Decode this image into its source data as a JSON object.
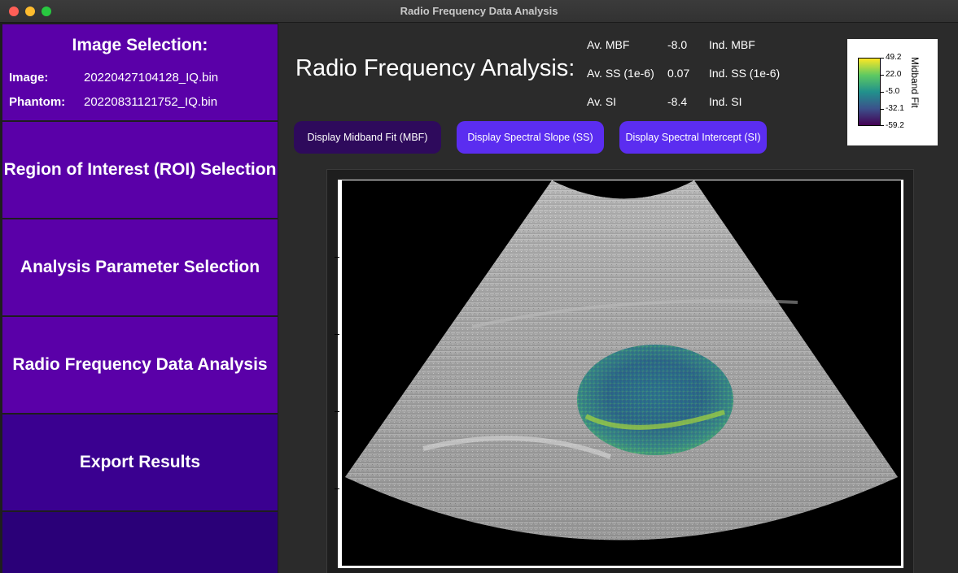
{
  "window": {
    "title": "Radio Frequency Data Analysis"
  },
  "sidebar": {
    "image_selection": {
      "title": "Image Selection:",
      "image_label": "Image:",
      "image_value": "20220427104128_IQ.bin",
      "phantom_label": "Phantom:",
      "phantom_value": "20220831121752_IQ.bin"
    },
    "roi_label": "Region of Interest (ROI) Selection",
    "param_label": "Analysis Parameter Selection",
    "rf_label": "Radio Frequency Data Analysis",
    "export_label": "Export Results"
  },
  "main": {
    "heading": "Radio Frequency Analysis:",
    "stats": {
      "av_mbf_label": "Av. MBF",
      "av_mbf_value": "-8.0",
      "ind_mbf_label": "Ind. MBF",
      "av_ss_label": "Av. SS (1e-6)",
      "av_ss_value": "0.07",
      "ind_ss_label": "Ind. SS (1e-6)",
      "av_si_label": "Av. SI",
      "av_si_value": "-8.4",
      "ind_si_label": "Ind. SI"
    },
    "buttons": {
      "mbf": "Display Midband Fit (MBF)",
      "ss": "Display Spectral Slope (SS)",
      "si": "Display Spectral Intercept (SI)"
    },
    "colorbar": {
      "title": "Midband Fit",
      "ticks": [
        "49.2",
        "22.0",
        "-5.0",
        "-32.1",
        "-59.2"
      ],
      "colors": [
        "#fde725",
        "#5ec962",
        "#21918c",
        "#3b528b",
        "#440154"
      ]
    }
  }
}
